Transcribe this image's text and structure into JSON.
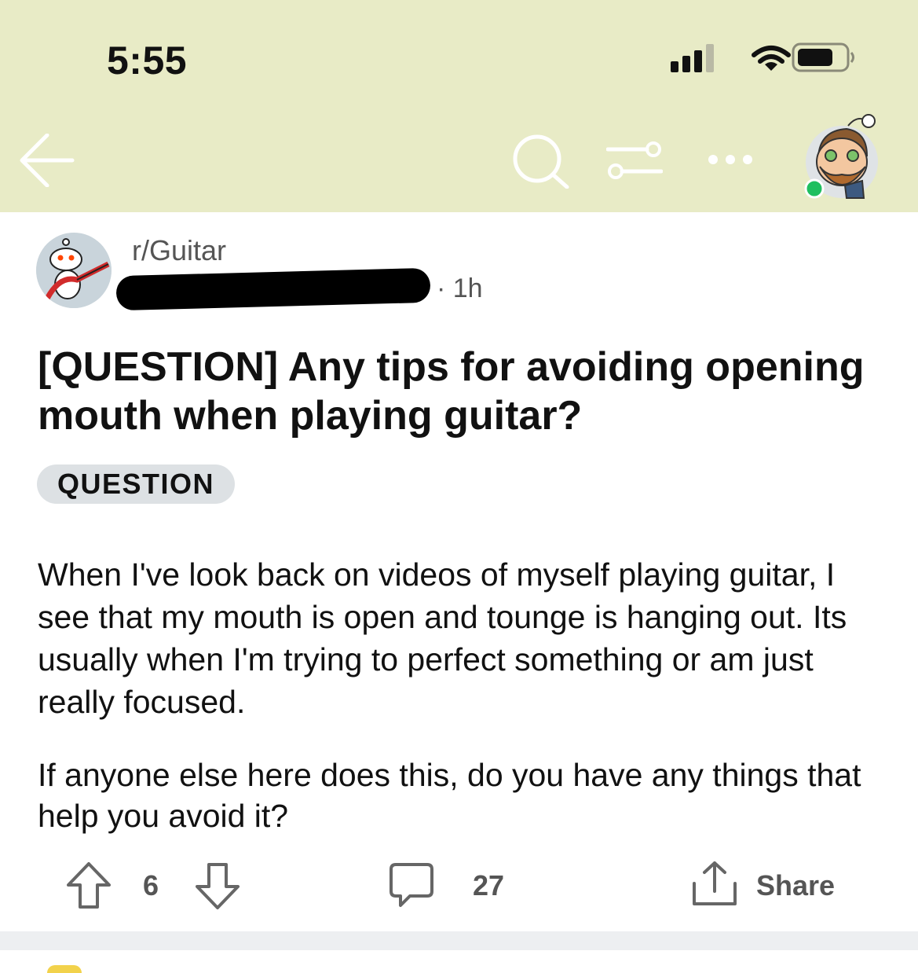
{
  "status_bar": {
    "time": "5:55"
  },
  "nav": {
    "back_icon": "arrow-left-icon",
    "search_icon": "search-icon",
    "filter_icon": "sort-filter-icon",
    "more_icon": "more-horizontal-icon",
    "accent_color": "#e8ebc6"
  },
  "post": {
    "subreddit": "r/Guitar",
    "age": "· 1h",
    "title": "[QUESTION] Any tips for avoiding opening mouth when playing guitar?",
    "flair": "QUESTION",
    "body": [
      "When I've look back on videos of myself playing guitar, I see that my mouth is open and tounge is hanging out. Its usually when I'm trying to perfect something or am just really focused.",
      "If anyone else here does this, do you have any things that help you avoid it?"
    ]
  },
  "actions": {
    "votes": "6",
    "comments": "27",
    "share_label": "Share"
  }
}
